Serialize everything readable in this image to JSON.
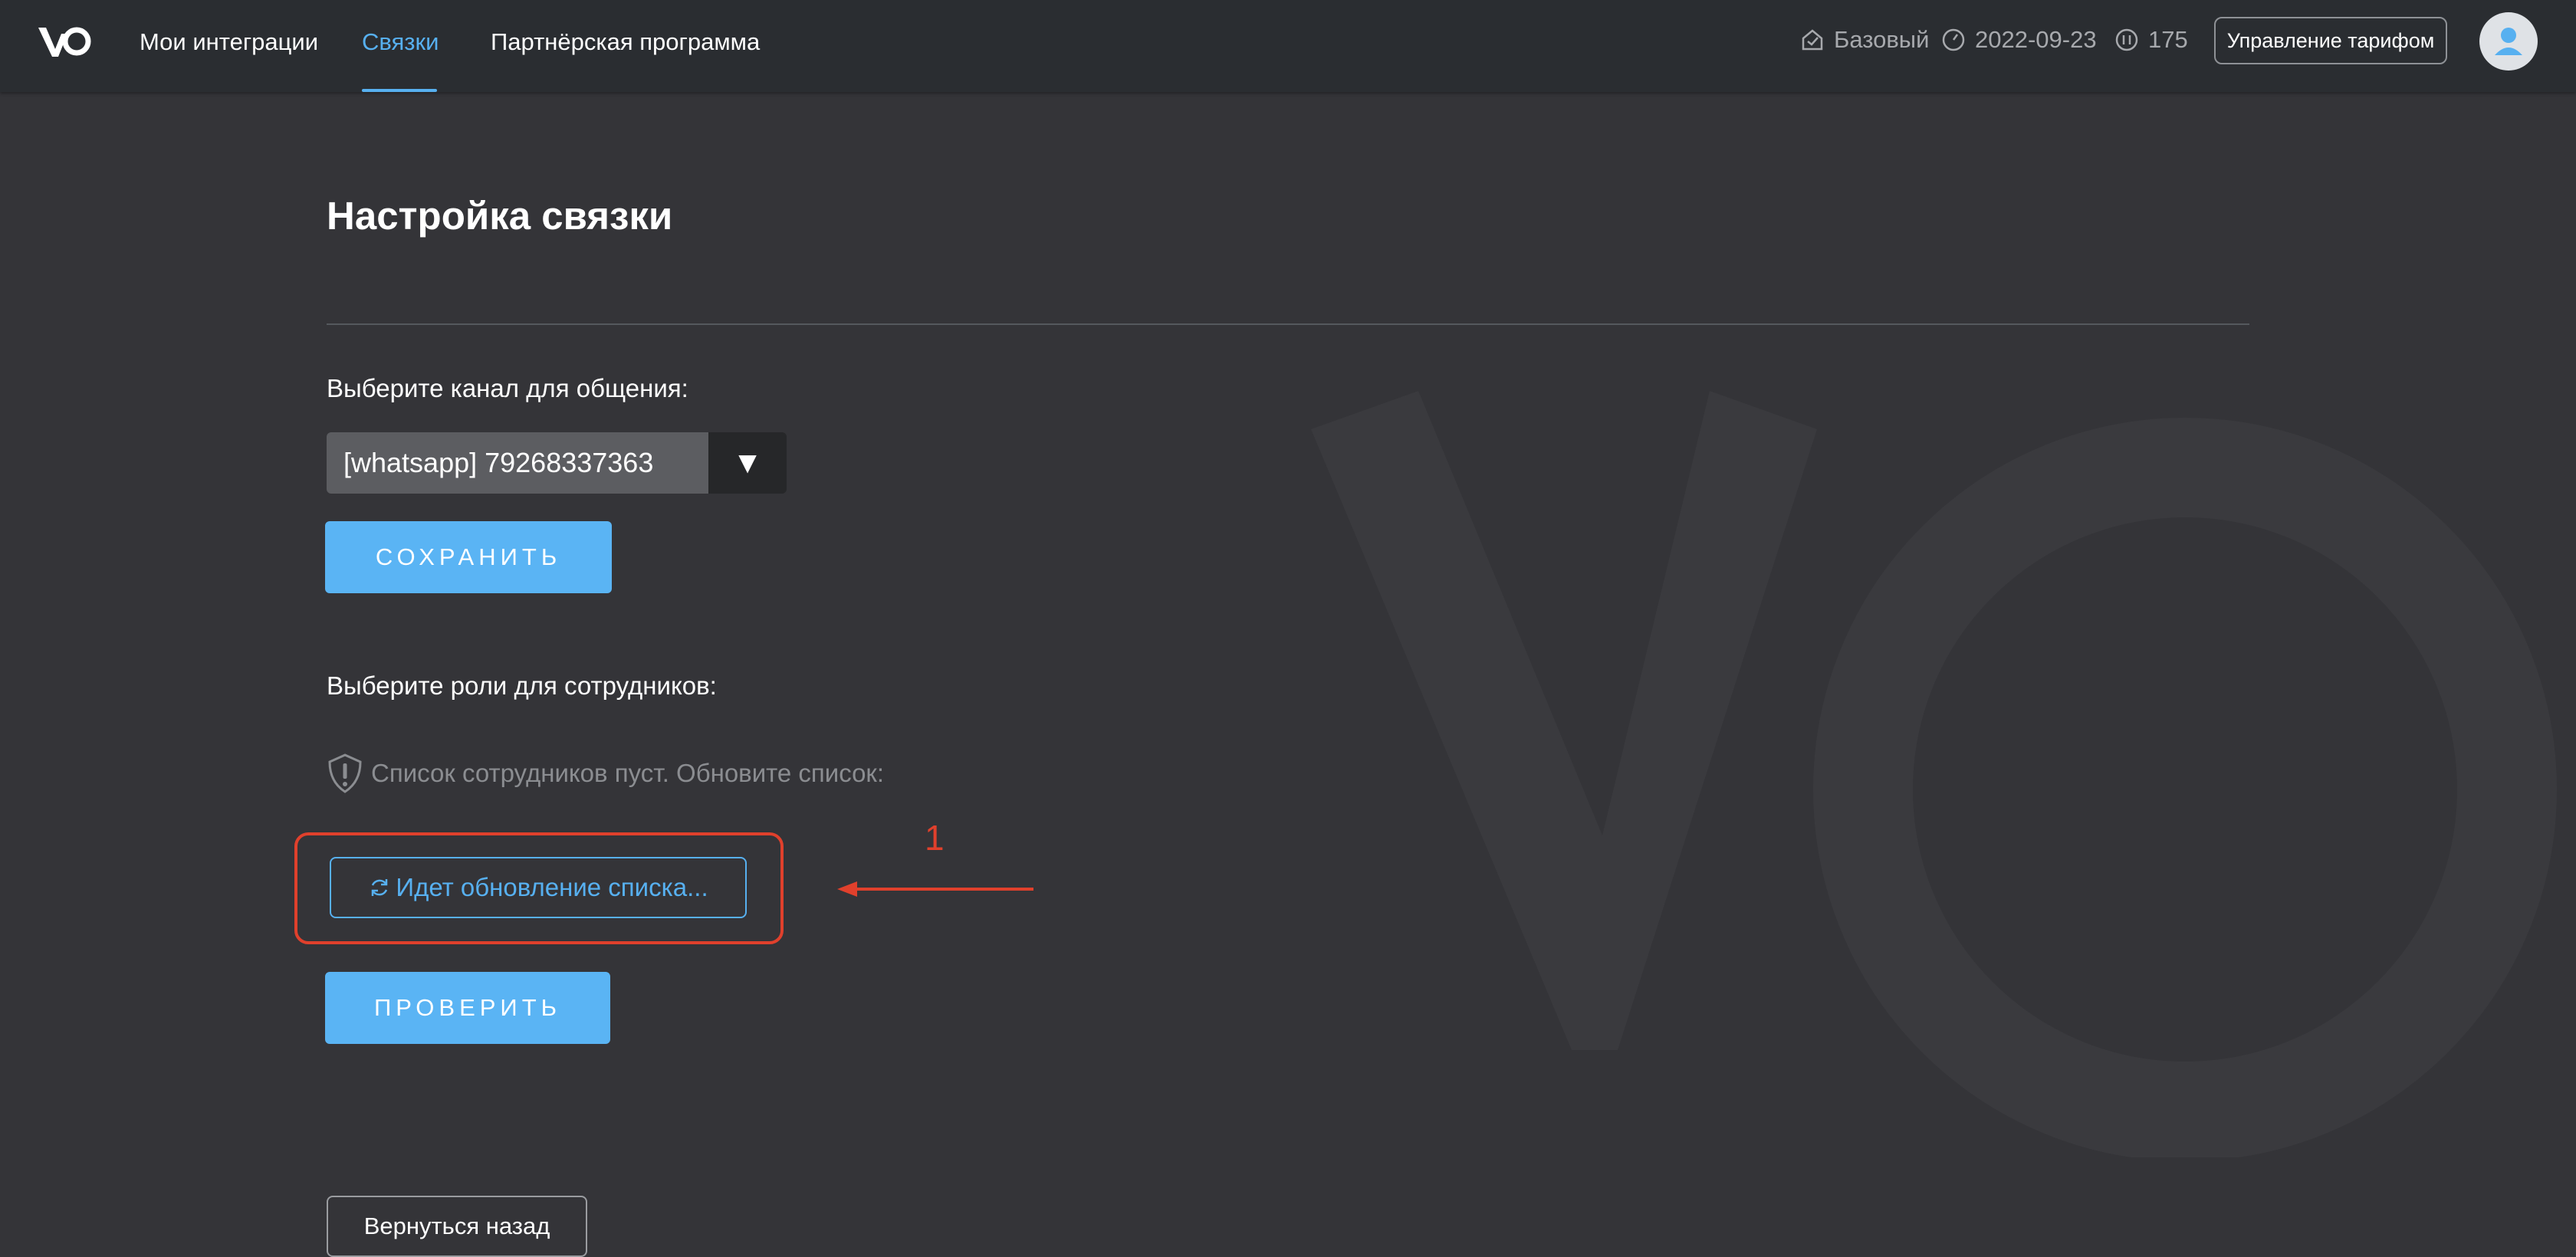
{
  "nav": {
    "items": [
      {
        "label": "Мои интеграции",
        "active": false
      },
      {
        "label": "Связки",
        "active": true
      },
      {
        "label": "Партнёрская программа",
        "active": false
      }
    ]
  },
  "tariff": {
    "plan": "Базовый",
    "date": "2022-09-23",
    "count": "175",
    "manage_label": "Управление тарифом"
  },
  "page": {
    "title": "Настройка связки",
    "channel_label": "Выберите канал для общения:",
    "channel_value": "[whatsapp] 79268337363",
    "save_label": "СОХРАНИТЬ",
    "roles_label": "Выберите роли для сотрудников:",
    "empty_warning": "Список сотрудников пуст. Обновите список:",
    "refresh_label": "Идет обновление списка...",
    "check_label": "ПРОВЕРИТЬ",
    "back_label": "Вернуться назад"
  },
  "annotation": {
    "number": "1"
  },
  "colors": {
    "background": "#343438",
    "topbar": "#2a2d31",
    "accent": "#57b0f0",
    "primary_button": "#5ab4f4",
    "annotation": "#e0402c"
  },
  "icons": [
    "logo-icon",
    "tariff-icon",
    "clock-icon",
    "counter-icon",
    "user-icon",
    "dropdown-arrow-icon",
    "warning-shield-icon",
    "refresh-icon",
    "arrow-left-icon"
  ]
}
